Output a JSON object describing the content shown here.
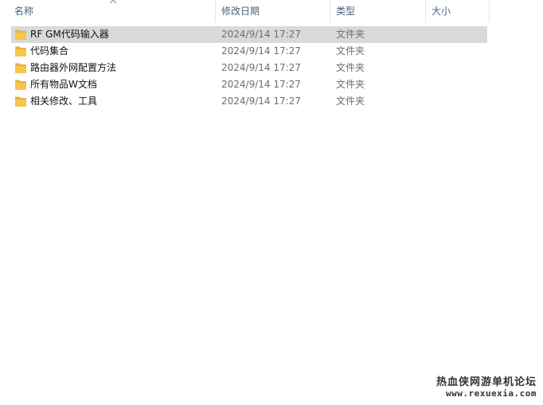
{
  "columns": {
    "name": "名称",
    "date_modified": "修改日期",
    "type": "类型",
    "size": "大小"
  },
  "sort": {
    "column": "name",
    "icon": "sort-ascending-chevron-icon"
  },
  "files": [
    {
      "name": "RF GM代码输入器",
      "date": "2024/9/14 17:27",
      "type": "文件夹",
      "size": "",
      "icon": "folder-icon",
      "selected": true
    },
    {
      "name": "代码集合",
      "date": "2024/9/14 17:27",
      "type": "文件夹",
      "size": "",
      "icon": "folder-icon",
      "selected": false
    },
    {
      "name": "路由器外网配置方法",
      "date": "2024/9/14 17:27",
      "type": "文件夹",
      "size": "",
      "icon": "folder-icon",
      "selected": false
    },
    {
      "name": "所有物品W文档",
      "date": "2024/9/14 17:27",
      "type": "文件夹",
      "size": "",
      "icon": "folder-icon",
      "selected": false
    },
    {
      "name": "相关修改、工具",
      "date": "2024/9/14 17:27",
      "type": "文件夹",
      "size": "",
      "icon": "folder-icon",
      "selected": false
    }
  ],
  "watermark": {
    "title": "热血侠网游单机论坛",
    "url": "www.rexuexia.com"
  },
  "colors": {
    "header_text": "#4c607a",
    "selected_row": "#d9d9d9",
    "folder": "#f4c64d",
    "secondary_text": "#6d6d6d"
  }
}
